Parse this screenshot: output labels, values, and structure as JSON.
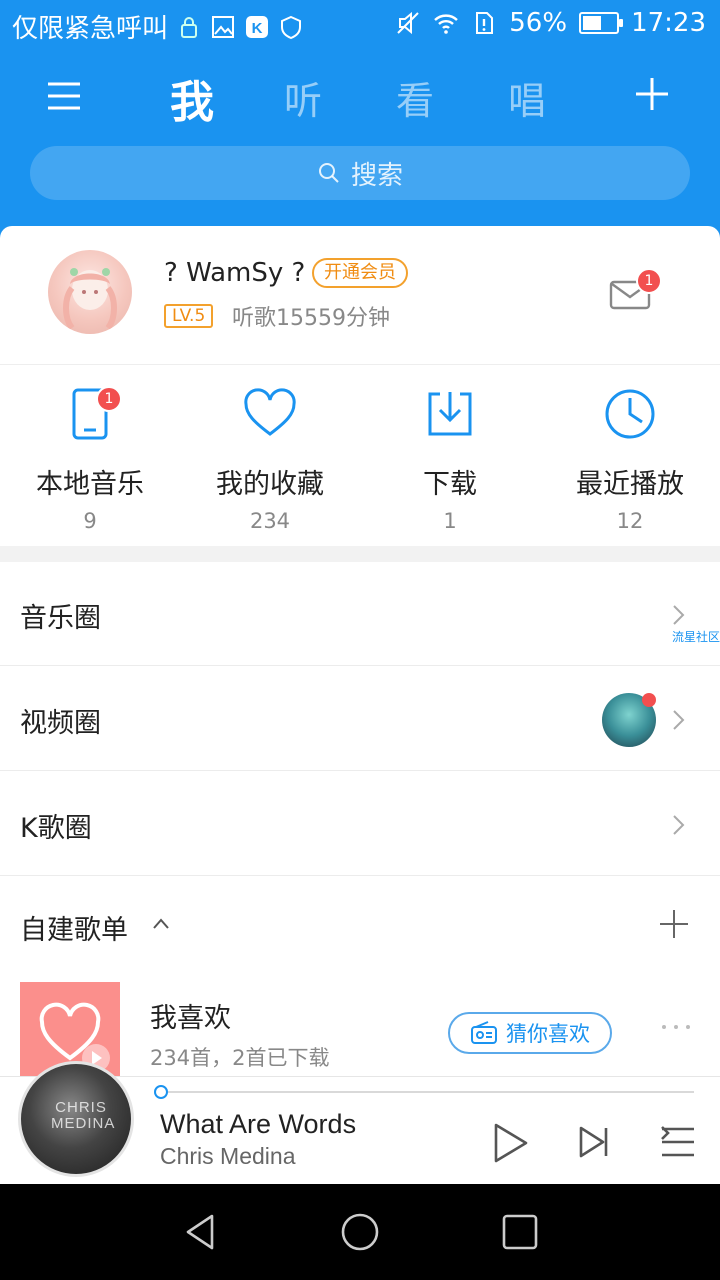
{
  "status": {
    "carrier": "仅限紧急呼叫",
    "battery": "56%",
    "battery_level": 0.56,
    "time": "17:23"
  },
  "nav": {
    "tabs": [
      "我",
      "听",
      "看",
      "唱"
    ],
    "active_tab": "我"
  },
  "search": {
    "placeholder": "搜索"
  },
  "profile": {
    "username": "? WamSy ?",
    "vip_label": "开通会员",
    "level": "LV.5",
    "listen_time": "听歌15559分钟",
    "mail_badge": "1"
  },
  "quick": {
    "items": [
      {
        "label": "本地音乐",
        "count": "9",
        "icon": "phone-icon",
        "badge": "1"
      },
      {
        "label": "我的收藏",
        "count": "234",
        "icon": "heart-icon"
      },
      {
        "label": "下载",
        "count": "1",
        "icon": "download-icon"
      },
      {
        "label": "最近播放",
        "count": "12",
        "icon": "clock-icon"
      }
    ]
  },
  "rows": {
    "music_circle": {
      "label": "音乐圈",
      "tag": "流星社区"
    },
    "video_circle": {
      "label": "视频圈"
    },
    "k_circle": {
      "label": "K歌圈"
    }
  },
  "playlists": {
    "header": "自建歌单",
    "fav": {
      "title": "我喜欢",
      "subtitle": "234首，2首已下载",
      "guess_label": "猜你喜欢"
    }
  },
  "player": {
    "song": "What Are Words",
    "artist": "Chris Medina",
    "cover_text": "CHRIS MEDINA",
    "progress": 0.0
  },
  "colors": {
    "brand_blue": "#1a93f0",
    "badge_red": "#f24f4f",
    "vip_orange": "#f08c12"
  }
}
